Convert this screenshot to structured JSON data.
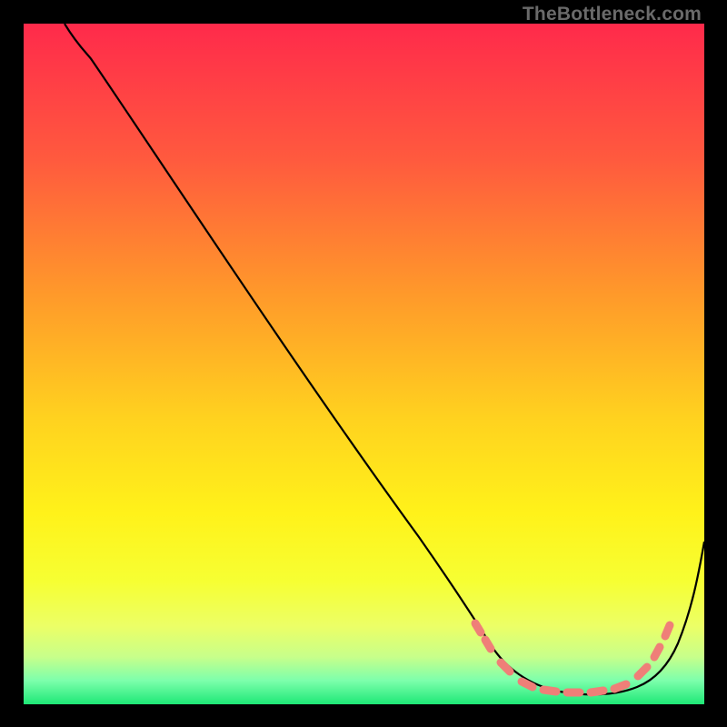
{
  "watermark": "TheBottleneck.com",
  "chart_data": {
    "type": "line",
    "title": "",
    "xlabel": "",
    "ylabel": "",
    "xlim": [
      0,
      100
    ],
    "ylim": [
      0,
      100
    ],
    "series": [
      {
        "name": "bottleneck-curve",
        "x": [
          6,
          10,
          20,
          30,
          40,
          50,
          58,
          63,
          67,
          72,
          77,
          82,
          86,
          90,
          94,
          100
        ],
        "y": [
          100,
          96,
          82,
          67,
          52,
          38,
          26,
          17,
          11,
          6,
          3,
          2,
          2,
          4,
          10,
          24
        ],
        "color": "#000000"
      }
    ],
    "valley_markers": {
      "approx_x_range": [
        63,
        93
      ],
      "color": "#ef7f78"
    },
    "background_gradient": {
      "stops": [
        {
          "pos": 0.0,
          "color": "#ff2a4b"
        },
        {
          "pos": 0.2,
          "color": "#ff5a3e"
        },
        {
          "pos": 0.4,
          "color": "#ff9a2a"
        },
        {
          "pos": 0.58,
          "color": "#ffd21f"
        },
        {
          "pos": 0.72,
          "color": "#fff21a"
        },
        {
          "pos": 0.82,
          "color": "#f6ff33"
        },
        {
          "pos": 0.885,
          "color": "#ecff66"
        },
        {
          "pos": 0.93,
          "color": "#c8ff8a"
        },
        {
          "pos": 0.965,
          "color": "#7dffac"
        },
        {
          "pos": 1.0,
          "color": "#1ee876"
        }
      ]
    }
  }
}
